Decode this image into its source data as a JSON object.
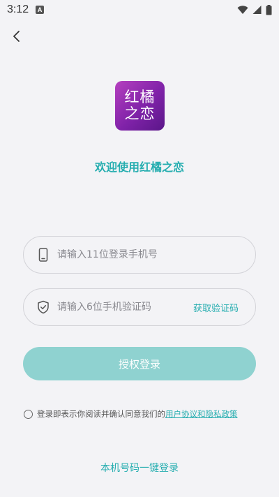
{
  "status_bar": {
    "time": "3:12",
    "notification_badge": "A",
    "icons": [
      "wifi-icon",
      "signal-icon",
      "battery-icon"
    ]
  },
  "header": {
    "back_icon": "chevron-left-icon"
  },
  "logo": {
    "line1": "红橘",
    "line2": "之恋",
    "gradient": [
      "#b53fbf",
      "#5a1689"
    ]
  },
  "welcome_text": "欢迎使用红橘之恋",
  "phone_field": {
    "icon": "phone-icon",
    "placeholder": "请输入11位登录手机号",
    "value": ""
  },
  "code_field": {
    "icon": "shield-icon",
    "placeholder": "请输入6位手机验证码",
    "value": "",
    "get_code_label": "获取验证码"
  },
  "login_button": {
    "label": "授权登录"
  },
  "agreement": {
    "text": "登录即表示你阅读并确认同意我们的",
    "link": "用户协议和隐私政策",
    "checked": false
  },
  "one_click_login": "本机号码一键登录",
  "colors": {
    "accent": "#27aeb0",
    "button": "#8fd2d0",
    "background": "#f3f3f6"
  }
}
